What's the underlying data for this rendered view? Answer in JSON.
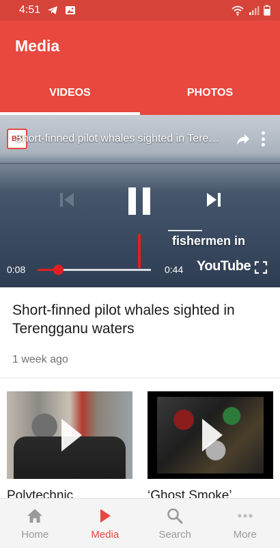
{
  "status_bar": {
    "time": "4:51",
    "battery_level": 0.8
  },
  "app_bar": {
    "title": "Media"
  },
  "tabs": [
    {
      "label": "VIDEOS",
      "active": true
    },
    {
      "label": "PHOTOS",
      "active": false
    }
  ],
  "player": {
    "channel_logo_text": "BH",
    "video_title": "Short-finned pilot whales sighted in Terengganu waters",
    "caption_text": "fishermen in",
    "time_current": "0:08",
    "time_total": "0:44",
    "progress": 0.18,
    "youtube_label": "YouTube"
  },
  "featured": {
    "title": "Short-finned pilot whales sighted in Terengganu waters",
    "date": "1 week ago"
  },
  "cards": [
    {
      "title": "Polytechnic"
    },
    {
      "title": "‘Ghost Smoke’"
    }
  ],
  "bottom_nav": [
    {
      "label": "Home",
      "icon": "home-icon",
      "active": false
    },
    {
      "label": "Media",
      "icon": "play-icon",
      "active": true
    },
    {
      "label": "Search",
      "icon": "search-icon",
      "active": false
    },
    {
      "label": "More",
      "icon": "more-horizontal-icon",
      "active": false
    }
  ],
  "colors": {
    "accent": "#e8483f",
    "status_bar": "#d64339",
    "nav_inactive": "#9a9a9a"
  }
}
